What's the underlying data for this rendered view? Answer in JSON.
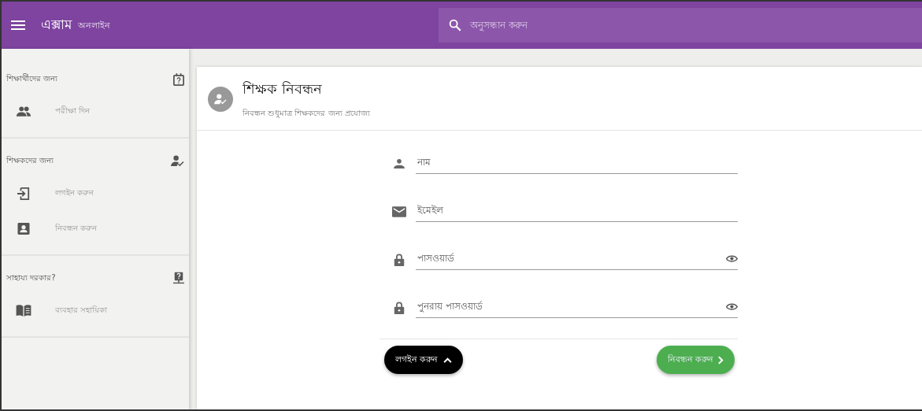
{
  "app_bar": {
    "title": "এক্সাম",
    "subtitle": "অনলাইন",
    "search": {
      "placeholder": "অনুসন্ধান করুন"
    }
  },
  "sidebar": {
    "sections": [
      {
        "heading": "শিক্ষার্থীদের জন্য",
        "items": [
          {
            "label": "পরীক্ষা দিন"
          }
        ]
      },
      {
        "heading": "শিক্ষকদের জন্য",
        "items": [
          {
            "label": "লগইন করুন"
          },
          {
            "label": "নিবন্ধন করুন"
          }
        ]
      },
      {
        "heading": "সাহায্য দরকার?",
        "items": [
          {
            "label": "ব্যবহার সহায়িকা"
          }
        ]
      }
    ]
  },
  "card": {
    "title": "শিক্ষক নিবন্ধন",
    "subtitle": "নিবন্ধন শুধুমাত্র শিক্ষকদের জন্য প্রযোজ্য",
    "fields": [
      {
        "kind": "name",
        "placeholder": "নাম"
      },
      {
        "kind": "email",
        "placeholder": "ইমেইল"
      },
      {
        "kind": "password",
        "placeholder": "পাসওয়ার্ড"
      },
      {
        "kind": "password",
        "placeholder": "পুনরায় পাসওয়ার্ড"
      }
    ],
    "buttons": [
      {
        "kind": "secondary",
        "label": "লগইন করুন"
      },
      {
        "kind": "primary",
        "label": "নিবন্ধন করুন"
      }
    ]
  }
}
